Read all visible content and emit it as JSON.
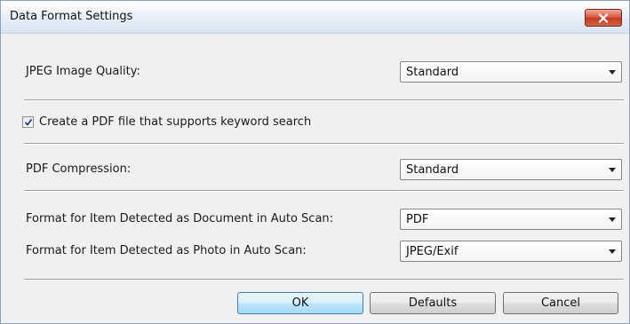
{
  "window": {
    "title": "Data Format Settings"
  },
  "jpeg_quality": {
    "label": "JPEG Image Quality:",
    "selected": "Standard"
  },
  "pdf_keyword": {
    "label": "Create a PDF file that supports keyword search",
    "checked": true
  },
  "pdf_compression": {
    "label": "PDF Compression:",
    "selected": "Standard"
  },
  "auto_scan_document": {
    "label": "Format for Item Detected as Document in Auto Scan:",
    "selected": "PDF"
  },
  "auto_scan_photo": {
    "label": "Format for Item Detected as Photo in Auto Scan:",
    "selected": "JPEG/Exif"
  },
  "buttons": {
    "ok": "OK",
    "defaults": "Defaults",
    "cancel": "Cancel"
  },
  "icons": {
    "close": "close-icon",
    "dropdown": "chevron-down-icon",
    "checkmark": "checkmark-icon"
  },
  "colors": {
    "close_button": "#c9452a",
    "default_button": "#bee6fd",
    "dialog_background": "#f0f0f0"
  }
}
